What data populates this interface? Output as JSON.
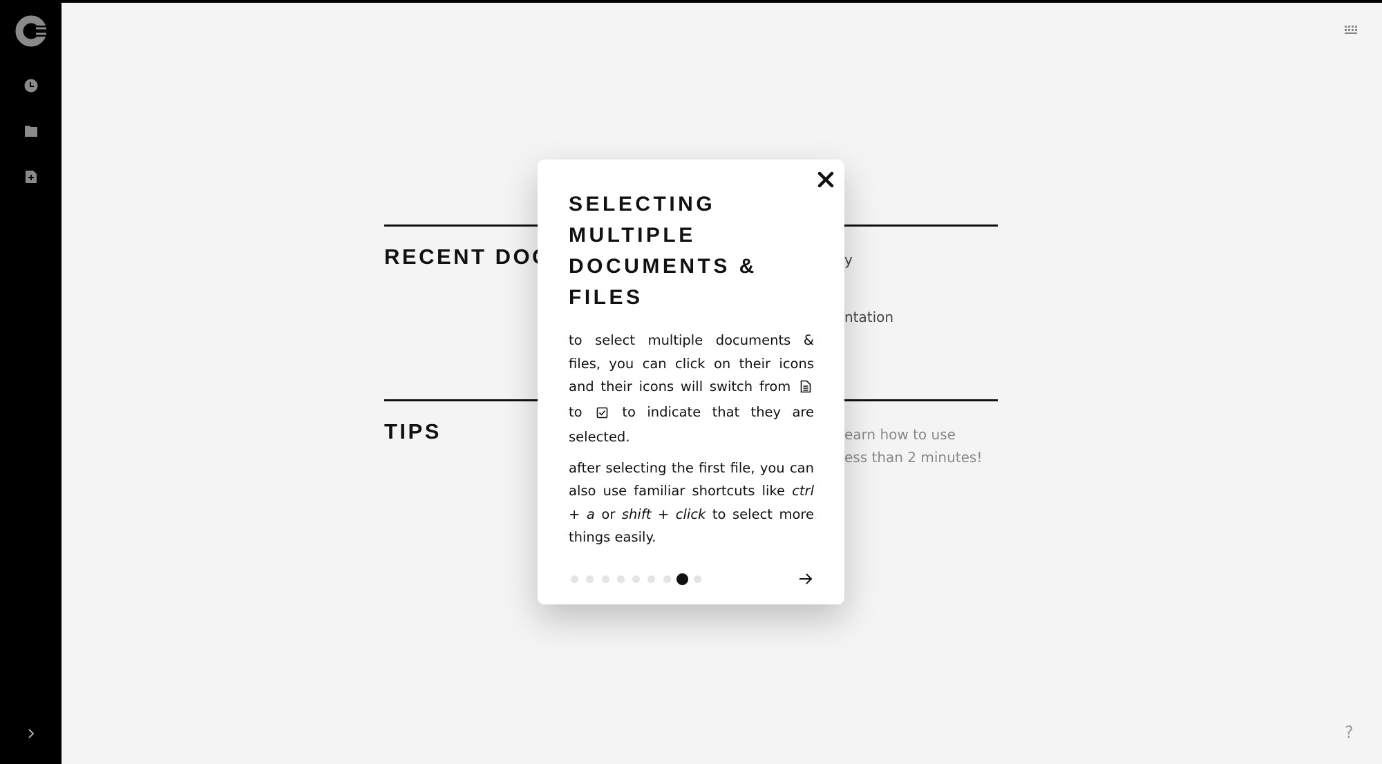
{
  "sidebar": {
    "logo": "brand-logo",
    "items": [
      {
        "name": "recent",
        "icon": "clock-icon"
      },
      {
        "name": "folders",
        "icon": "folder-icon"
      },
      {
        "name": "new-document",
        "icon": "new-document-icon"
      }
    ],
    "expand_icon": "chevron-right-icon"
  },
  "topright": {
    "icon": "keyboard-icon"
  },
  "help": {
    "label": "?"
  },
  "sections": {
    "recent": {
      "title": "RECENT DOCUMENTS",
      "fragments": [
        "y",
        "ntation"
      ]
    },
    "tips": {
      "title": "TIPS",
      "fragments": [
        "earn how to use",
        "ess than 2 minutes!"
      ]
    }
  },
  "modal": {
    "title": "SELECTING MULTIPLE DOCUMENTS & FILES",
    "p1_a": "to select multiple documents & files, you can click on their icons and their icons will switch from",
    "p1_b": "to",
    "p1_c": "to indicate that they are selected.",
    "p2_a": "after selecting the first file, you can also use familiar shortcuts like",
    "p2_ctrl": "ctrl + a",
    "p2_or": "or",
    "p2_shift": "shift + click",
    "p2_b": "to select more things easily.",
    "page_count": 9,
    "current_page": 8,
    "colors": {
      "active_dot": "#111111",
      "inactive_dot": "#e4e4e4"
    }
  }
}
